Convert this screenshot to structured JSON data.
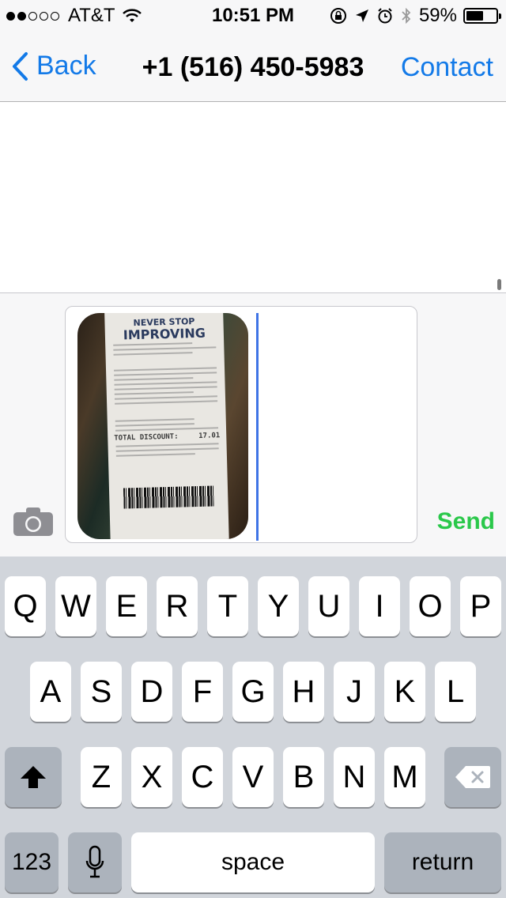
{
  "status_bar": {
    "carrier": "AT&T",
    "signal_bars_filled": 2,
    "signal_bars_total": 5,
    "time": "10:51 PM",
    "battery": "59%",
    "battery_level": 0.59,
    "icons": [
      "wifi-icon",
      "rotation-lock-icon",
      "location-arrow-icon",
      "alarm-icon",
      "bluetooth-icon",
      "battery-icon"
    ]
  },
  "nav": {
    "back_label": "Back",
    "title": "+1 (516) 450-5983",
    "contact_label": "Contact"
  },
  "compose": {
    "attachment": {
      "type": "image",
      "description_icon": "receipt-photo",
      "receipt_header_line1": "NEVER STOP",
      "receipt_header_line2": "IMPROVING",
      "receipt_total_label": "TOTAL DISCOUNT:",
      "receipt_total_value": "17.01"
    },
    "send_label": "Send"
  },
  "keyboard": {
    "row1": [
      "Q",
      "W",
      "E",
      "R",
      "T",
      "Y",
      "U",
      "I",
      "O",
      "P"
    ],
    "row2": [
      "A",
      "S",
      "D",
      "F",
      "G",
      "H",
      "J",
      "K",
      "L"
    ],
    "row3": [
      "Z",
      "X",
      "C",
      "V",
      "B",
      "N",
      "M"
    ],
    "numbers_label": "123",
    "space_label": "space",
    "return_label": "return"
  },
  "colors": {
    "accent": "#137ae8",
    "send": "#2ac84a",
    "cursor": "#3f74e6",
    "keyboard_bg": "#d1d5db"
  }
}
